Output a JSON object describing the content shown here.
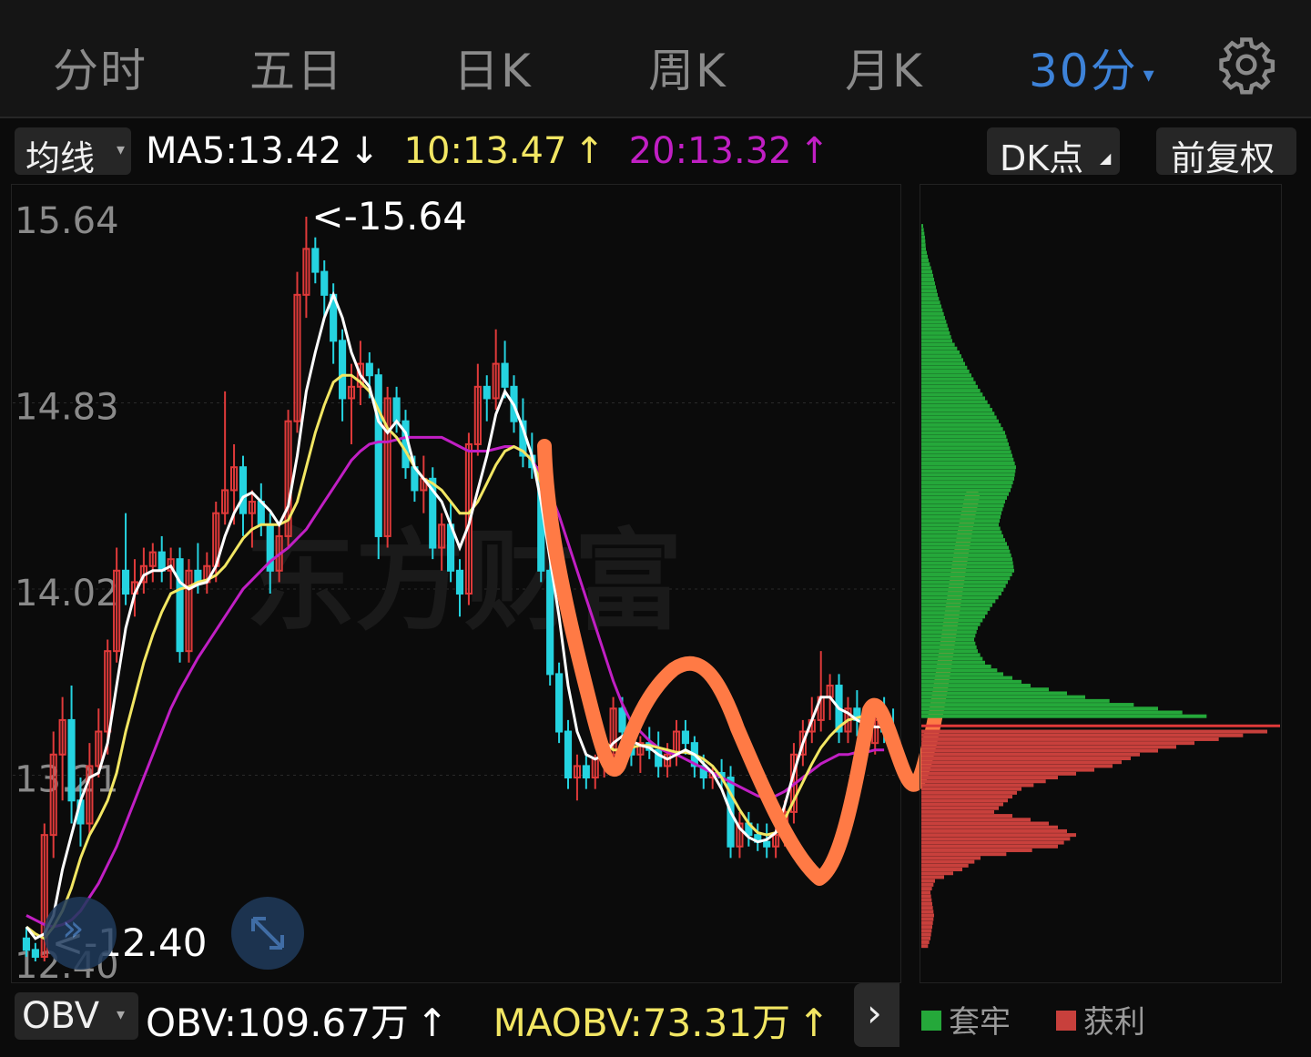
{
  "tabs": [
    {
      "label": "分时",
      "active": false
    },
    {
      "label": "五日",
      "active": false
    },
    {
      "label": "日K",
      "active": false
    },
    {
      "label": "周K",
      "active": false
    },
    {
      "label": "月K",
      "active": false
    },
    {
      "label": "30分",
      "active": true
    }
  ],
  "toolbar": {
    "ma_selector": "均线",
    "ma5": "MA5:13.42",
    "ma5_arrow": "↓",
    "ma10": "10:13.47",
    "ma10_arrow": "↑",
    "ma20": "20:13.32",
    "ma20_arrow": "↑",
    "dk_button": "DK点",
    "adjust_button": "前复权"
  },
  "indicator": {
    "selector": "OBV",
    "obv": "OBV:109.67万",
    "obv_arrow": "↑",
    "maobv": "MAOBV:73.31万",
    "maobv_arrow": "↑"
  },
  "volume_profile_legend": {
    "trapped": "套牢",
    "profit": "获利"
  },
  "colors": {
    "up": "#e03a3a",
    "down": "#25d3e0",
    "ma5": "#ffffff",
    "ma10": "#f2e663",
    "ma20": "#c11fc4",
    "trapped": "#25a83a",
    "profit": "#c8403c",
    "active_tab": "#3d82d8",
    "annotation": "#ff7a45"
  },
  "chart_data": {
    "type": "candlestick",
    "price_ticks": [
      "15.64",
      "14.83",
      "14.02",
      "13.21",
      "12.40"
    ],
    "ylim": [
      12.4,
      15.64
    ],
    "high_marker": "<-15.64",
    "low_marker": "<-12.40",
    "ohlc": [
      [
        12.5,
        12.55,
        12.42,
        12.45
      ],
      [
        12.45,
        12.48,
        12.4,
        12.42
      ],
      [
        12.42,
        13.0,
        12.4,
        12.95
      ],
      [
        12.95,
        13.4,
        12.85,
        13.3
      ],
      [
        13.3,
        13.55,
        13.1,
        13.45
      ],
      [
        13.45,
        13.6,
        13.0,
        13.1
      ],
      [
        13.1,
        13.2,
        12.9,
        13.0
      ],
      [
        13.0,
        13.35,
        12.95,
        13.25
      ],
      [
        13.25,
        13.5,
        13.2,
        13.4
      ],
      [
        13.4,
        13.8,
        13.3,
        13.75
      ],
      [
        13.75,
        14.2,
        13.7,
        14.1
      ],
      [
        14.1,
        14.35,
        13.95,
        14.0
      ],
      [
        14.0,
        14.15,
        13.9,
        14.05
      ],
      [
        14.05,
        14.2,
        14.0,
        14.12
      ],
      [
        14.12,
        14.22,
        14.05,
        14.18
      ],
      [
        14.18,
        14.25,
        14.05,
        14.1
      ],
      [
        14.1,
        14.2,
        14.02,
        14.15
      ],
      [
        14.15,
        14.2,
        13.7,
        13.75
      ],
      [
        13.75,
        14.15,
        13.7,
        14.1
      ],
      [
        14.1,
        14.22,
        14.0,
        14.05
      ],
      [
        14.05,
        14.18,
        14.0,
        14.12
      ],
      [
        14.12,
        14.4,
        14.05,
        14.35
      ],
      [
        14.35,
        14.88,
        14.3,
        14.45
      ],
      [
        14.45,
        14.65,
        14.3,
        14.55
      ],
      [
        14.55,
        14.6,
        14.25,
        14.35
      ],
      [
        14.35,
        14.45,
        14.2,
        14.4
      ],
      [
        14.4,
        14.48,
        14.25,
        14.3
      ],
      [
        14.3,
        14.35,
        14.0,
        14.1
      ],
      [
        14.1,
        14.3,
        14.05,
        14.25
      ],
      [
        14.25,
        14.8,
        14.2,
        14.75
      ],
      [
        14.75,
        15.4,
        14.7,
        15.3
      ],
      [
        15.3,
        15.64,
        15.2,
        15.5
      ],
      [
        15.5,
        15.55,
        15.35,
        15.4
      ],
      [
        15.4,
        15.45,
        15.2,
        15.3
      ],
      [
        15.3,
        15.35,
        15.0,
        15.1
      ],
      [
        15.1,
        15.15,
        14.75,
        14.85
      ],
      [
        14.85,
        15.0,
        14.65,
        14.9
      ],
      [
        14.9,
        15.1,
        14.82,
        15.0
      ],
      [
        15.0,
        15.05,
        14.85,
        14.95
      ],
      [
        14.95,
        14.98,
        14.15,
        14.25
      ],
      [
        14.25,
        14.9,
        14.2,
        14.85
      ],
      [
        14.85,
        14.9,
        14.7,
        14.75
      ],
      [
        14.75,
        14.8,
        14.5,
        14.55
      ],
      [
        14.55,
        14.6,
        14.4,
        14.45
      ],
      [
        14.45,
        14.6,
        14.35,
        14.5
      ],
      [
        14.5,
        14.55,
        14.15,
        14.2
      ],
      [
        14.2,
        14.35,
        14.1,
        14.3
      ],
      [
        14.3,
        14.4,
        14.05,
        14.1
      ],
      [
        14.1,
        14.15,
        13.9,
        14.0
      ],
      [
        14.0,
        14.7,
        13.95,
        14.65
      ],
      [
        14.65,
        15.0,
        14.6,
        14.9
      ],
      [
        14.9,
        14.95,
        14.75,
        14.85
      ],
      [
        14.85,
        15.15,
        14.8,
        15.0
      ],
      [
        15.0,
        15.1,
        14.85,
        14.9
      ],
      [
        14.9,
        14.95,
        14.7,
        14.75
      ],
      [
        14.75,
        14.85,
        14.55,
        14.6
      ],
      [
        14.6,
        14.7,
        14.5,
        14.55
      ],
      [
        14.55,
        14.6,
        14.05,
        14.1
      ],
      [
        14.1,
        14.15,
        13.6,
        13.65
      ],
      [
        13.65,
        13.7,
        13.35,
        13.4
      ],
      [
        13.4,
        13.45,
        13.15,
        13.2
      ],
      [
        13.2,
        13.3,
        13.1,
        13.25
      ],
      [
        13.25,
        13.3,
        13.15,
        13.2
      ],
      [
        13.2,
        13.3,
        13.15,
        13.28
      ],
      [
        13.28,
        13.35,
        13.2,
        13.3
      ],
      [
        13.3,
        13.55,
        13.25,
        13.5
      ],
      [
        13.5,
        13.55,
        13.35,
        13.4
      ],
      [
        13.4,
        13.45,
        13.25,
        13.3
      ],
      [
        13.3,
        13.38,
        13.22,
        13.35
      ],
      [
        13.35,
        13.42,
        13.28,
        13.32
      ],
      [
        13.32,
        13.4,
        13.2,
        13.25
      ],
      [
        13.25,
        13.35,
        13.2,
        13.3
      ],
      [
        13.3,
        13.45,
        13.25,
        13.4
      ],
      [
        13.4,
        13.45,
        13.3,
        13.35
      ],
      [
        13.35,
        13.38,
        13.2,
        13.25
      ],
      [
        13.25,
        13.3,
        13.15,
        13.2
      ],
      [
        13.2,
        13.25,
        13.15,
        13.22
      ],
      [
        13.22,
        13.28,
        13.15,
        13.2
      ],
      [
        13.2,
        13.25,
        12.85,
        12.9
      ],
      [
        12.9,
        13.05,
        12.85,
        13.0
      ],
      [
        13.0,
        13.05,
        12.9,
        12.95
      ],
      [
        12.95,
        13.0,
        12.88,
        12.92
      ],
      [
        12.92,
        13.0,
        12.85,
        12.9
      ],
      [
        12.9,
        12.98,
        12.85,
        12.95
      ],
      [
        12.95,
        13.1,
        12.9,
        13.05
      ],
      [
        13.05,
        13.35,
        13.0,
        13.3
      ],
      [
        13.3,
        13.45,
        13.25,
        13.4
      ],
      [
        13.4,
        13.55,
        13.35,
        13.45
      ],
      [
        13.45,
        13.75,
        13.4,
        13.55
      ],
      [
        13.55,
        13.65,
        13.45,
        13.6
      ],
      [
        13.6,
        13.65,
        13.35,
        13.4
      ],
      [
        13.4,
        13.55,
        13.35,
        13.5
      ],
      [
        13.5,
        13.58,
        13.38,
        13.45
      ],
      [
        13.45,
        13.5,
        13.3,
        13.35
      ],
      [
        13.35,
        13.5,
        13.3,
        13.45
      ],
      [
        13.45,
        13.55,
        13.35,
        13.4
      ],
      [
        13.4,
        13.5,
        13.3,
        13.35
      ]
    ],
    "ma5": [
      12.55,
      12.5,
      12.52,
      12.6,
      12.8,
      12.95,
      13.1,
      13.2,
      13.22,
      13.35,
      13.6,
      13.85,
      14.0,
      14.08,
      14.1,
      14.1,
      14.12,
      14.05,
      14.02,
      14.04,
      14.05,
      14.12,
      14.25,
      14.35,
      14.42,
      14.44,
      14.4,
      14.36,
      14.3,
      14.38,
      14.6,
      14.88,
      15.05,
      15.2,
      15.3,
      15.2,
      15.05,
      14.95,
      14.9,
      14.75,
      14.7,
      14.75,
      14.7,
      14.55,
      14.5,
      14.45,
      14.4,
      14.3,
      14.2,
      14.3,
      14.45,
      14.6,
      14.78,
      14.88,
      14.82,
      14.72,
      14.6,
      14.4,
      14.15,
      13.9,
      13.6,
      13.4,
      13.3,
      13.28,
      13.3,
      13.35,
      13.38,
      13.36,
      13.34,
      13.33,
      13.3,
      13.28,
      13.3,
      13.32,
      13.3,
      13.26,
      13.22,
      13.15,
      13.05,
      12.98,
      12.94,
      12.92,
      12.93,
      12.96,
      13.08,
      13.22,
      13.35,
      13.45,
      13.55,
      13.55,
      13.5,
      13.48,
      13.45,
      13.43,
      13.42,
      13.42
    ],
    "ma10": [
      12.55,
      12.52,
      12.5,
      12.55,
      12.62,
      12.72,
      12.85,
      12.95,
      13.02,
      13.1,
      13.22,
      13.4,
      13.55,
      13.7,
      13.82,
      13.92,
      14.0,
      14.02,
      14.03,
      14.05,
      14.06,
      14.08,
      14.12,
      14.18,
      14.24,
      14.28,
      14.3,
      14.3,
      14.3,
      14.32,
      14.4,
      14.55,
      14.7,
      14.82,
      14.92,
      14.95,
      14.95,
      14.92,
      14.88,
      14.8,
      14.72,
      14.68,
      14.62,
      14.55,
      14.5,
      14.48,
      14.45,
      14.4,
      14.35,
      14.35,
      14.4,
      14.48,
      14.56,
      14.62,
      14.64,
      14.62,
      14.58,
      14.48,
      14.35,
      14.18,
      13.98,
      13.78,
      13.6,
      13.45,
      13.36,
      13.32,
      13.32,
      13.33,
      13.34,
      13.34,
      13.33,
      13.32,
      13.31,
      13.31,
      13.3,
      13.28,
      13.25,
      13.2,
      13.13,
      13.06,
      13.0,
      12.96,
      12.95,
      12.96,
      13.02,
      13.1,
      13.18,
      13.26,
      13.33,
      13.38,
      13.42,
      13.45,
      13.46,
      13.47,
      13.47,
      13.47
    ],
    "ma20": [
      12.6,
      12.58,
      12.56,
      12.55,
      12.56,
      12.58,
      12.62,
      12.68,
      12.74,
      12.82,
      12.9,
      13.0,
      13.1,
      13.2,
      13.3,
      13.4,
      13.5,
      13.58,
      13.65,
      13.72,
      13.78,
      13.84,
      13.9,
      13.96,
      14.02,
      14.06,
      14.1,
      14.14,
      14.17,
      14.2,
      14.24,
      14.28,
      14.34,
      14.4,
      14.46,
      14.52,
      14.58,
      14.62,
      14.65,
      14.66,
      14.66,
      14.67,
      14.68,
      14.68,
      14.68,
      14.68,
      14.68,
      14.66,
      14.64,
      14.62,
      14.62,
      14.62,
      14.63,
      14.64,
      14.64,
      14.62,
      14.58,
      14.52,
      14.44,
      14.34,
      14.22,
      14.1,
      13.98,
      13.86,
      13.74,
      13.62,
      13.52,
      13.44,
      13.4,
      13.36,
      13.33,
      13.31,
      13.3,
      13.28,
      13.26,
      13.24,
      13.22,
      13.2,
      13.18,
      13.16,
      13.14,
      13.12,
      13.11,
      13.12,
      13.14,
      13.17,
      13.2,
      13.23,
      13.26,
      13.28,
      13.3,
      13.3,
      13.31,
      13.31,
      13.32,
      13.32
    ],
    "volume_profile": {
      "trapped_levels": [
        15.6,
        15.55,
        15.5,
        15.45,
        15.4,
        15.35,
        15.3,
        15.25,
        15.2,
        15.15,
        15.1,
        15.05,
        15.0,
        14.95,
        14.9,
        14.85,
        14.8,
        14.75,
        14.7,
        14.65,
        14.6,
        14.55,
        14.5,
        14.45,
        14.4,
        14.35,
        14.3,
        14.25,
        14.2,
        14.15,
        14.1,
        14.05,
        14.0,
        13.95,
        13.9,
        13.85,
        13.8,
        13.75,
        13.7,
        13.65,
        13.6,
        13.55,
        13.5,
        13.45
      ],
      "trapped_volumes": [
        2,
        4,
        5,
        8,
        12,
        15,
        18,
        22,
        26,
        30,
        34,
        42,
        48,
        55,
        62,
        70,
        78,
        85,
        92,
        96,
        100,
        104,
        102,
        98,
        92,
        88,
        85,
        90,
        96,
        100,
        102,
        95,
        88,
        78,
        70,
        62,
        58,
        62,
        70,
        90,
        120,
        180,
        260,
        340
      ],
      "profit_levels": [
        13.4,
        13.35,
        13.3,
        13.25,
        13.2,
        13.15,
        13.1,
        13.05,
        13.0,
        12.95,
        12.9,
        12.85,
        12.8,
        12.75,
        12.7,
        12.65,
        12.6,
        12.55,
        12.5,
        12.45
      ],
      "profit_volumes": [
        380,
        300,
        240,
        210,
        150,
        110,
        95,
        80,
        140,
        170,
        150,
        65,
        45,
        15,
        10,
        12,
        14,
        12,
        10,
        6
      ]
    }
  }
}
